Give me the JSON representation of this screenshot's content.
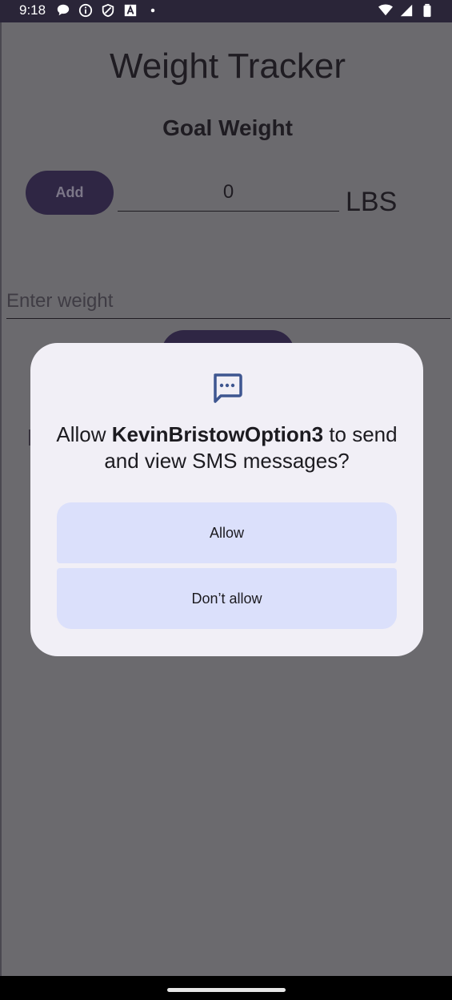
{
  "status_bar": {
    "time": "9:18",
    "left_icons": [
      "chat-bubble-icon",
      "info-icon",
      "shield-icon",
      "text-a-icon",
      "dot-icon"
    ],
    "right_icons": [
      "wifi-icon",
      "signal-icon",
      "battery-icon"
    ]
  },
  "app": {
    "title": "Weight Tracker",
    "goal_label": "Goal Weight",
    "add_button": "Add",
    "goal_value": "0",
    "unit": "LBS",
    "weight_placeholder": "Enter weight"
  },
  "dialog": {
    "icon": "sms-message-icon",
    "message_prefix": "Allow ",
    "app_name": "KevinBristowOption3",
    "message_suffix": " to send and view SMS messages?",
    "allow_label": "Allow",
    "deny_label": "Don’t allow"
  },
  "colors": {
    "scrim": "#6b6a6e",
    "dialog_bg": "#f1eff6",
    "button_bg": "#dbe0fb",
    "accent": "#3e5690",
    "status_bar": "#2a2538"
  }
}
